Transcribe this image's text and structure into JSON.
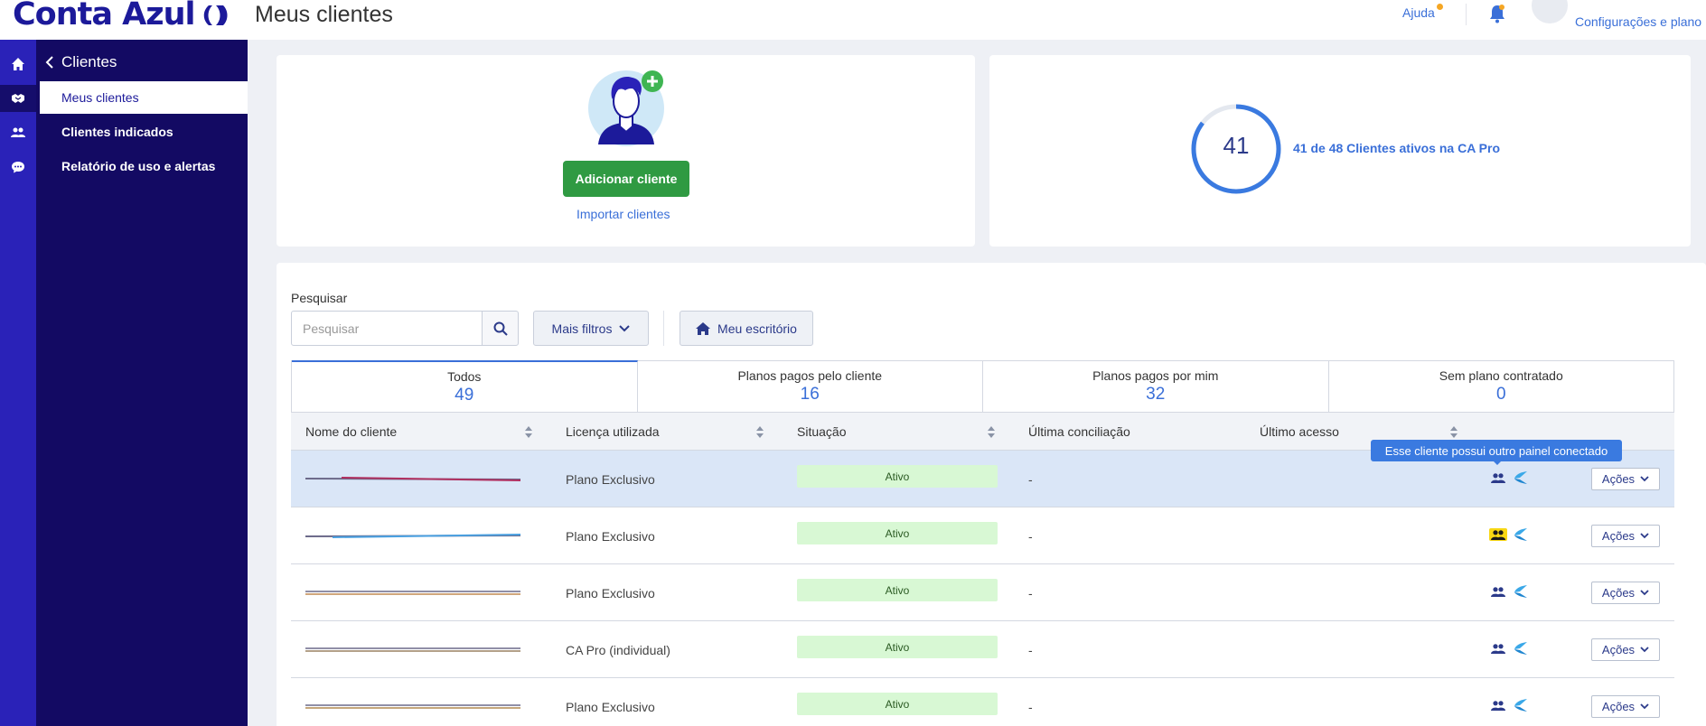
{
  "app": {
    "logo_text": "Conta Azul",
    "page_title": "Meus clientes"
  },
  "topbar": {
    "help_label": "Ajuda",
    "settings_label": "Configurações e plano"
  },
  "rail": {
    "icons": [
      "home-icon",
      "handshake-icon",
      "users-icon",
      "chat-icon"
    ],
    "active_index": 1
  },
  "sidebar": {
    "heading": "Clientes",
    "items": [
      {
        "label": "Meus clientes",
        "active": true
      },
      {
        "label": "Clientes indicados",
        "active": false
      },
      {
        "label": "Relatório de uso e alertas",
        "active": false
      }
    ]
  },
  "add_card": {
    "add_button_label": "Adicionar cliente",
    "import_link_label": "Importar clientes"
  },
  "stats_card": {
    "active_count": "41",
    "summary_label": "41 de 48 Clientes ativos na CA Pro",
    "active_fraction": 0.854
  },
  "search": {
    "label": "Pesquisar",
    "placeholder": "Pesquisar",
    "value": ""
  },
  "filters": {
    "more_filters_label": "Mais filtros",
    "my_office_label": "Meu escritório"
  },
  "tabs": [
    {
      "label": "Todos",
      "count": "49",
      "active": true
    },
    {
      "label": "Planos pagos pelo cliente",
      "count": "16",
      "active": false
    },
    {
      "label": "Planos pagos por mim",
      "count": "32",
      "active": false
    },
    {
      "label": "Sem plano contratado",
      "count": "0",
      "active": false
    }
  ],
  "table": {
    "columns": [
      "Nome do cliente",
      "Licença utilizada",
      "Situação",
      "Última conciliação",
      "Último acesso"
    ],
    "rows": [
      {
        "license": "Plano Exclusivo",
        "status": "Ativo",
        "last_reconciliation": "-",
        "highlighted": true,
        "connected_panel_flag": false,
        "action_label": "Ações"
      },
      {
        "license": "Plano Exclusivo",
        "status": "Ativo",
        "last_reconciliation": "-",
        "highlighted": false,
        "connected_panel_flag": true,
        "action_label": "Ações"
      },
      {
        "license": "Plano Exclusivo",
        "status": "Ativo",
        "last_reconciliation": "-",
        "highlighted": false,
        "connected_panel_flag": false,
        "action_label": "Ações"
      },
      {
        "license": "CA Pro (individual)",
        "status": "Ativo",
        "last_reconciliation": "-",
        "highlighted": false,
        "connected_panel_flag": false,
        "action_label": "Ações"
      },
      {
        "license": "Plano Exclusivo",
        "status": "Ativo",
        "last_reconciliation": "-",
        "highlighted": false,
        "connected_panel_flag": false,
        "action_label": "Ações"
      }
    ]
  },
  "tooltip": {
    "text": "Esse cliente possui outro painel conectado"
  },
  "colors": {
    "brand": "#1c1a9a",
    "rail": "#2a22b8",
    "sidebar": "#130a63",
    "accent": "#3a6fd8",
    "success": "#2f9a42",
    "status_bg": "#d8f8d4",
    "highlight_row": "#dae6f7",
    "warning_flag": "#f8d713"
  }
}
